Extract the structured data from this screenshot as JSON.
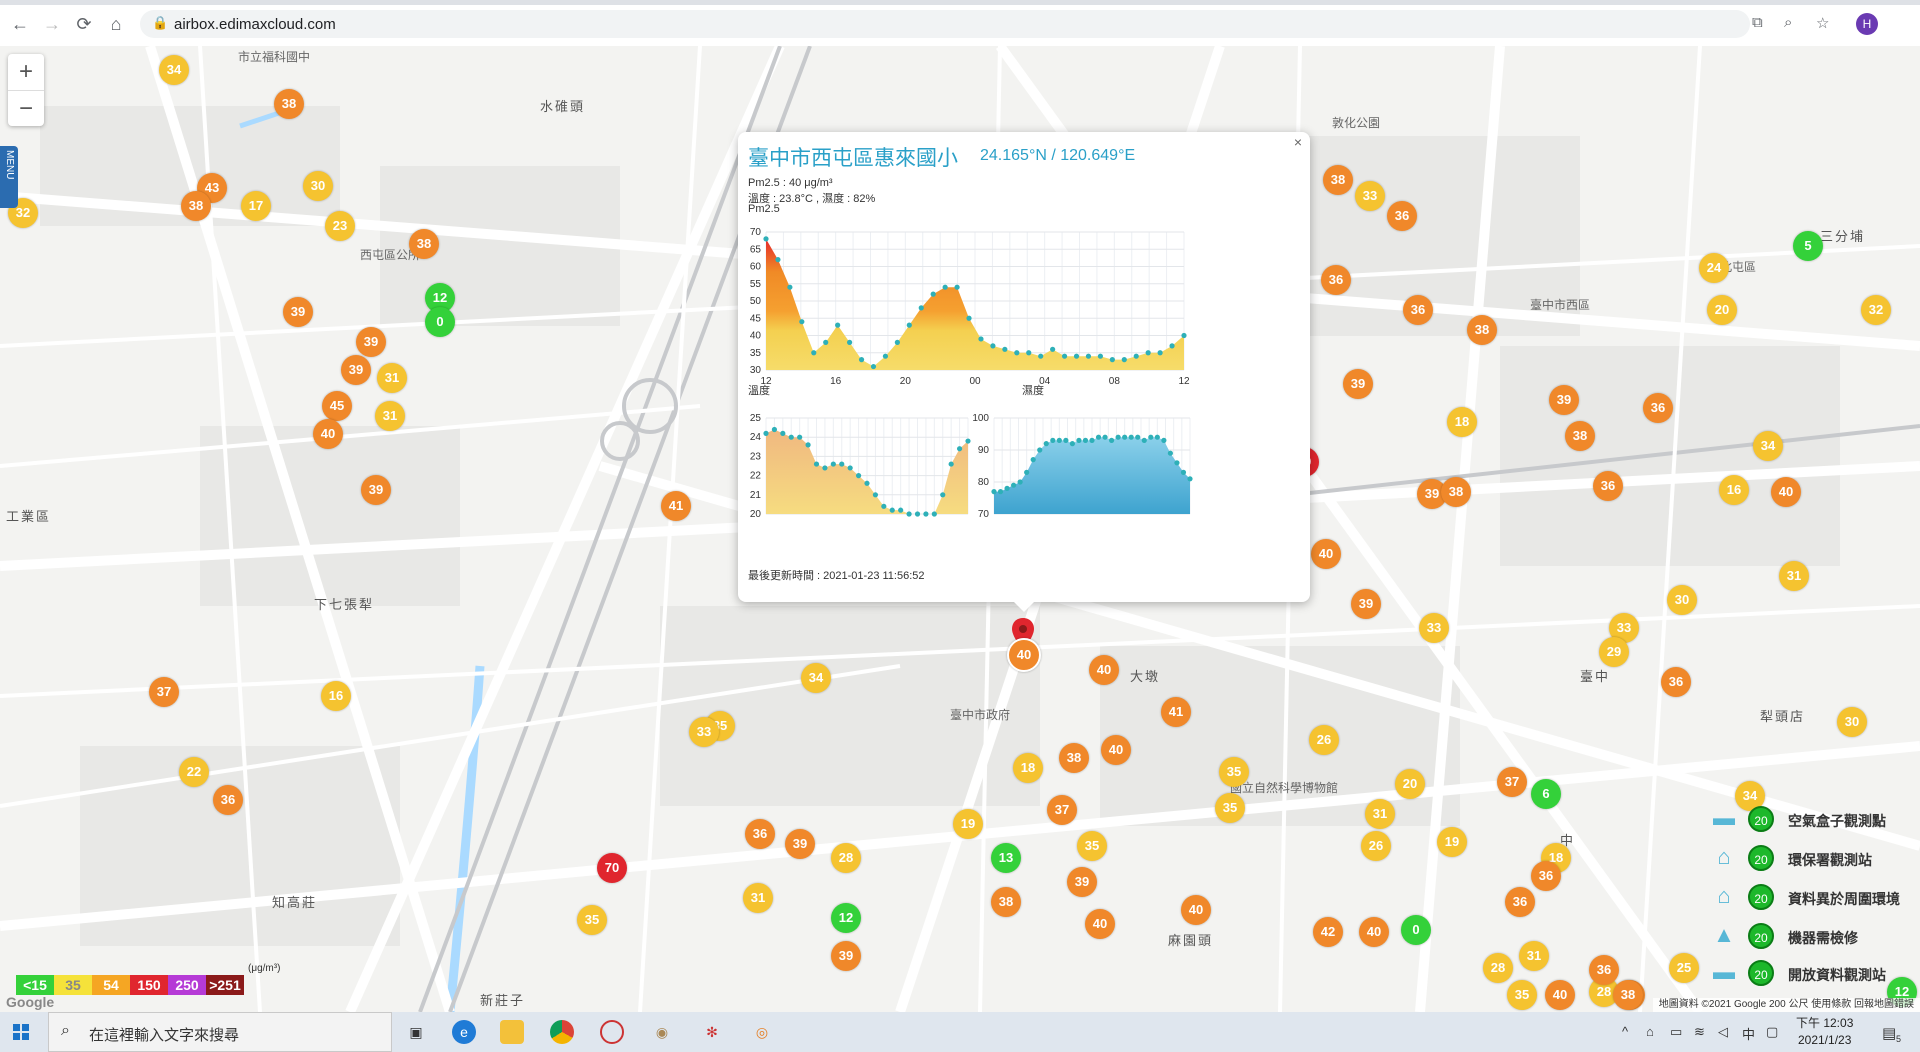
{
  "browser": {
    "url": "airbox.edimaxcloud.com",
    "profile_initial": "H",
    "icons": [
      "back-icon",
      "forward-icon",
      "reload-icon",
      "home-icon",
      "lock-icon",
      "translate-icon",
      "zoom-icon",
      "star-icon"
    ]
  },
  "map": {
    "zoom_in": "+",
    "zoom_out": "−",
    "menu_label": "MENU",
    "place_labels": [
      {
        "text": "水碓頭",
        "big": true
      },
      {
        "text": "市立福科國中"
      },
      {
        "text": "西屯區公所"
      },
      {
        "text": "臺中市西區"
      },
      {
        "text": "臺中市政府"
      },
      {
        "text": "下七張犁",
        "big": true
      },
      {
        "text": "大墩",
        "big": true
      },
      {
        "text": "知高莊",
        "big": true
      },
      {
        "text": "敦化公園"
      },
      {
        "text": "三分埔",
        "big": true
      },
      {
        "text": "北屯區"
      },
      {
        "text": "臺中",
        "big": true
      },
      {
        "text": "國立自然科學博物館"
      },
      {
        "text": "工業區",
        "big": true
      },
      {
        "text": "新莊子",
        "big": true
      },
      {
        "text": "麻園頭",
        "big": true
      },
      {
        "text": "中",
        "big": true
      },
      {
        "text": "犁頭店",
        "big": true
      }
    ],
    "markers": [
      {
        "v": "34",
        "c": "#f5c330"
      },
      {
        "v": "38",
        "c": "#f0882a"
      },
      {
        "v": "32",
        "c": "#f5c330"
      },
      {
        "v": "43",
        "c": "#f0882a"
      },
      {
        "v": "38",
        "c": "#f0882a"
      },
      {
        "v": "17",
        "c": "#f5c330"
      },
      {
        "v": "30",
        "c": "#f5c330"
      },
      {
        "v": "23",
        "c": "#f5c330"
      },
      {
        "v": "38",
        "c": "#f0882a"
      },
      {
        "v": "12",
        "c": "#34d13a"
      },
      {
        "v": "0",
        "c": "#34d13a"
      },
      {
        "v": "39",
        "c": "#f0882a"
      },
      {
        "v": "39",
        "c": "#f0882a"
      },
      {
        "v": "39",
        "c": "#f0882a"
      },
      {
        "v": "31",
        "c": "#f5c330"
      },
      {
        "v": "45",
        "c": "#f0882a"
      },
      {
        "v": "40",
        "c": "#f0882a"
      },
      {
        "v": "31",
        "c": "#f5c330"
      },
      {
        "v": "39",
        "c": "#f0882a"
      },
      {
        "v": "41",
        "c": "#f0882a"
      },
      {
        "v": "37",
        "c": "#f0882a"
      },
      {
        "v": "16",
        "c": "#f5c330"
      },
      {
        "v": "22",
        "c": "#f5c330"
      },
      {
        "v": "36",
        "c": "#f0882a"
      },
      {
        "v": "35",
        "c": "#f5c330"
      },
      {
        "v": "70",
        "c": "#e0262e"
      },
      {
        "v": "35",
        "c": "#f5c330"
      },
      {
        "v": "33",
        "c": "#f5c330"
      },
      {
        "v": "36",
        "c": "#f0882a"
      },
      {
        "v": "39",
        "c": "#f0882a"
      },
      {
        "v": "31",
        "c": "#f5c330"
      },
      {
        "v": "28",
        "c": "#f5c330"
      },
      {
        "v": "12",
        "c": "#34d13a"
      },
      {
        "v": "39",
        "c": "#f0882a"
      },
      {
        "v": "34",
        "c": "#f5c330"
      },
      {
        "v": "40",
        "c": "#f0882a"
      },
      {
        "v": "19",
        "c": "#f5c330"
      },
      {
        "v": "13",
        "c": "#34d13a"
      },
      {
        "v": "38",
        "c": "#f0882a"
      },
      {
        "v": "18",
        "c": "#f5c330"
      },
      {
        "v": "38",
        "c": "#f0882a"
      },
      {
        "v": "37",
        "c": "#f0882a"
      },
      {
        "v": "35",
        "c": "#f5c330"
      },
      {
        "v": "39",
        "c": "#f0882a"
      },
      {
        "v": "40",
        "c": "#f0882a"
      },
      {
        "v": "40",
        "c": "#f0882a"
      },
      {
        "v": "41",
        "c": "#f0882a"
      },
      {
        "v": "35",
        "c": "#f5c330"
      },
      {
        "v": "26",
        "c": "#f5c330"
      },
      {
        "v": "35",
        "c": "#f5c330"
      },
      {
        "v": "40",
        "c": "#f0882a"
      },
      {
        "v": "42",
        "c": "#f0882a"
      },
      {
        "v": "40",
        "c": "#f0882a"
      },
      {
        "v": "59",
        "c": "#e0262e"
      },
      {
        "v": "40",
        "c": "#f0882a"
      },
      {
        "v": "38",
        "c": "#f0882a"
      },
      {
        "v": "33",
        "c": "#f5c330"
      },
      {
        "v": "36",
        "c": "#f0882a"
      },
      {
        "v": "36",
        "c": "#f0882a"
      },
      {
        "v": "36",
        "c": "#f0882a"
      },
      {
        "v": "38",
        "c": "#f0882a"
      },
      {
        "v": "39",
        "c": "#f0882a"
      },
      {
        "v": "18",
        "c": "#f5c330"
      },
      {
        "v": "39",
        "c": "#f0882a"
      },
      {
        "v": "38",
        "c": "#f0882a"
      },
      {
        "v": "39",
        "c": "#f0882a"
      },
      {
        "v": "33",
        "c": "#f5c330"
      },
      {
        "v": "31",
        "c": "#f5c330"
      },
      {
        "v": "26",
        "c": "#f5c330"
      },
      {
        "v": "19",
        "c": "#f5c330"
      },
      {
        "v": "20",
        "c": "#f5c330"
      },
      {
        "v": "0",
        "c": "#34d13a"
      },
      {
        "v": "28",
        "c": "#f5c330"
      },
      {
        "v": "37",
        "c": "#f0882a"
      },
      {
        "v": "6",
        "c": "#34d13a"
      },
      {
        "v": "18",
        "c": "#f5c330"
      },
      {
        "v": "36",
        "c": "#f0882a"
      },
      {
        "v": "36",
        "c": "#f0882a"
      },
      {
        "v": "31",
        "c": "#f5c330"
      },
      {
        "v": "5",
        "c": "#34d13a"
      },
      {
        "v": "24",
        "c": "#f5c330"
      },
      {
        "v": "20",
        "c": "#f5c330"
      },
      {
        "v": "32",
        "c": "#f5c330"
      },
      {
        "v": "36",
        "c": "#f0882a"
      },
      {
        "v": "38",
        "c": "#f0882a"
      },
      {
        "v": "39",
        "c": "#f0882a"
      },
      {
        "v": "34",
        "c": "#f5c330"
      },
      {
        "v": "16",
        "c": "#f5c330"
      },
      {
        "v": "40",
        "c": "#f0882a"
      },
      {
        "v": "31",
        "c": "#f5c330"
      },
      {
        "v": "36",
        "c": "#f0882a"
      },
      {
        "v": "30",
        "c": "#f5c330"
      },
      {
        "v": "33",
        "c": "#f5c330"
      },
      {
        "v": "29",
        "c": "#f5c330"
      },
      {
        "v": "36",
        "c": "#f0882a"
      },
      {
        "v": "30",
        "c": "#f5c330"
      },
      {
        "v": "34",
        "c": "#f5c330"
      },
      {
        "v": "25",
        "c": "#f5c330"
      },
      {
        "v": "28",
        "c": "#f5c330"
      },
      {
        "v": "12",
        "c": "#34d13a"
      },
      {
        "v": "40",
        "c": "#f0882a"
      },
      {
        "v": "38",
        "c": "#f0882a"
      },
      {
        "v": "35",
        "c": "#f5c330"
      },
      {
        "v": "40",
        "c": "#f0882a"
      },
      {
        "v": "36",
        "c": "#f0882a"
      }
    ],
    "selected_marker": "40",
    "legend": [
      {
        "label": "空氣盒子觀測點",
        "badge": "20",
        "icon": "airbox-icon"
      },
      {
        "label": "環保署觀測站",
        "badge": "20",
        "icon": "epa-station-icon"
      },
      {
        "label": "資料異於周圍環境",
        "badge": "20",
        "icon": "anomaly-icon"
      },
      {
        "label": "機器需檢修",
        "badge": "20",
        "icon": "repair-icon"
      },
      {
        "label": "開放資料觀測站",
        "badge": "20",
        "icon": "open-data-icon"
      }
    ],
    "scale": {
      "unit": "(μg/m³)",
      "levels": [
        {
          "label": "<15",
          "bg": "#34d13a",
          "fg": "#ffffff"
        },
        {
          "label": "35",
          "bg": "#f5e23a",
          "fg": "#888888"
        },
        {
          "label": "54",
          "bg": "#f5a623",
          "fg": "#ffffff"
        },
        {
          "label": "150",
          "bg": "#e0262e",
          "fg": "#ffffff"
        },
        {
          "label": "250",
          "bg": "#b53ad6",
          "fg": "#ffffff"
        },
        {
          "label": ">251",
          "bg": "#8b1a1a",
          "fg": "#ffffff"
        }
      ]
    },
    "attribution": "地圖資料 ©2021 Google   200 公尺   使用條款   回報地圖錯誤",
    "watermark": "Google"
  },
  "popup": {
    "title": "臺中市西屯區惠來國小",
    "coords": "24.165°N / 120.649°E",
    "pm25_line": "Pm2.5 : 40 μg/m³",
    "temp_humid_line": "溫度 : 23.8°C , 濕度 : 82%",
    "chart_label": "Pm2.5",
    "temp_label": "溫度",
    "humid_label": "濕度",
    "updated": "最後更新時間 : 2021-01-23 11:56:52",
    "close": "×"
  },
  "chart_data": [
    {
      "type": "area",
      "title": "Pm2.5",
      "x_tick_labels": [
        "12",
        "16",
        "20",
        "00",
        "04",
        "08",
        "12"
      ],
      "ylim": [
        30,
        70
      ],
      "y_ticks": [
        30,
        35,
        40,
        45,
        50,
        55,
        60,
        65,
        70
      ],
      "values": [
        68,
        62,
        54,
        44,
        35,
        38,
        43,
        38,
        33,
        31,
        34,
        38,
        43,
        48,
        52,
        54,
        54,
        45,
        39,
        37,
        36,
        35,
        35,
        34,
        36,
        34,
        34,
        34,
        34,
        33,
        33,
        34,
        35,
        35,
        37,
        40
      ],
      "grid": true
    },
    {
      "type": "area",
      "title": "溫度",
      "ylim": [
        20,
        25
      ],
      "y_ticks": [
        20,
        21,
        22,
        23,
        24,
        25
      ],
      "values": [
        24.2,
        24.4,
        24.2,
        24.0,
        24.0,
        23.6,
        22.6,
        22.4,
        22.6,
        22.6,
        22.4,
        22.0,
        21.6,
        21.0,
        20.4,
        20.2,
        20.2,
        20.0,
        20.0,
        20.0,
        20.0,
        21.0,
        22.6,
        23.4,
        23.8
      ],
      "grid": true
    },
    {
      "type": "area",
      "title": "濕度",
      "ylim": [
        70,
        100
      ],
      "y_ticks": [
        70,
        80,
        90,
        100
      ],
      "values": [
        77,
        77,
        78,
        79,
        80,
        83,
        87,
        90,
        92,
        93,
        93,
        93,
        92,
        93,
        93,
        93,
        94,
        94,
        93,
        94,
        94,
        94,
        94,
        93,
        94,
        94,
        93,
        89,
        86,
        83,
        81
      ],
      "grid": true
    }
  ],
  "taskbar": {
    "search_placeholder": "在這裡輸入文字來搜尋",
    "time": "下午 12:03",
    "date": "2021/1/23",
    "ime": "中",
    "notification_count": "5"
  }
}
